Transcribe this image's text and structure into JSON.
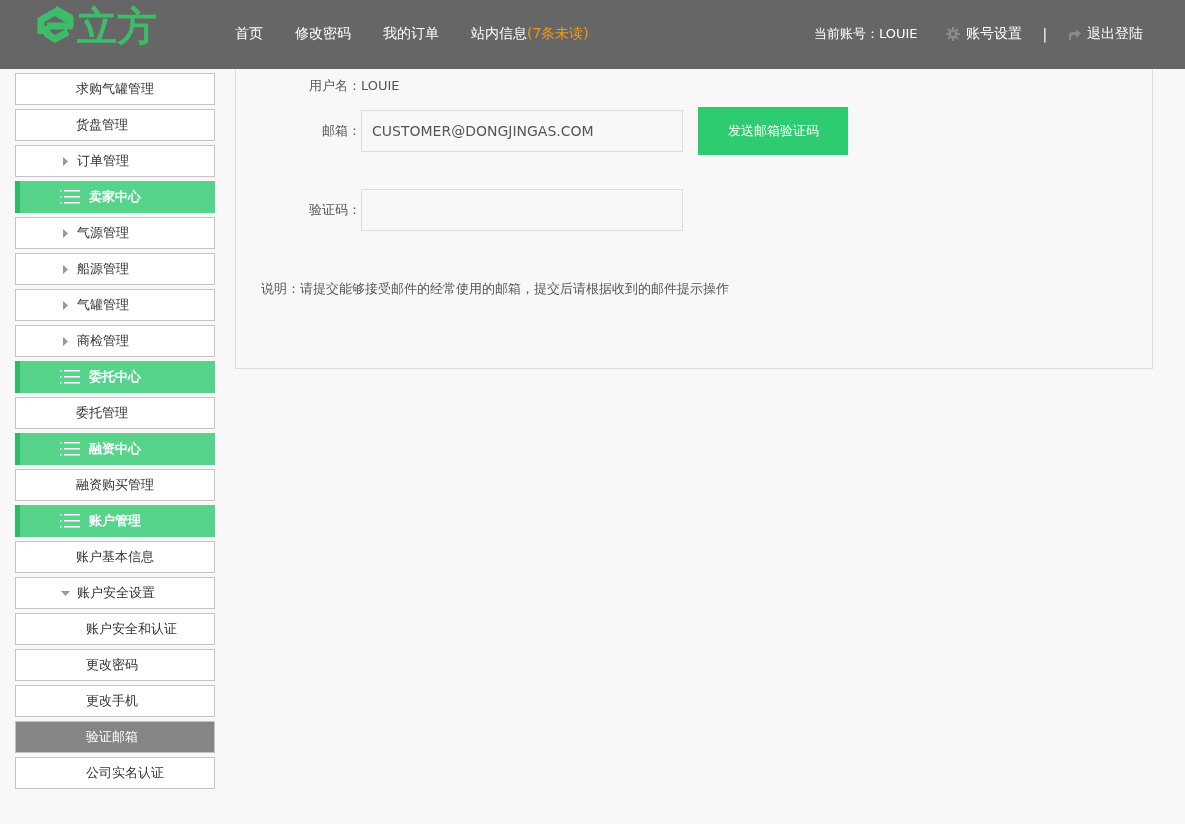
{
  "header": {
    "logo_text": "立方",
    "nav": [
      {
        "label": "首页"
      },
      {
        "label": "修改密码"
      },
      {
        "label": "我的订单"
      },
      {
        "label": "站内信息",
        "badge": "(7条未读)"
      }
    ],
    "account": "当前账号：LOUIE",
    "settings": "账号设置",
    "separator": "|",
    "logout": "退出登陆"
  },
  "sidebar": {
    "items": [
      {
        "kind": "item",
        "label": "求购气罐管理",
        "selected": false
      },
      {
        "kind": "item",
        "label": "货盘管理",
        "selected": false
      },
      {
        "kind": "group",
        "label": "订单管理",
        "expanded": false,
        "selected": false
      },
      {
        "kind": "header",
        "label": "卖家中心"
      },
      {
        "kind": "group",
        "label": "气源管理",
        "expanded": false,
        "selected": false
      },
      {
        "kind": "group",
        "label": "船源管理",
        "expanded": false,
        "selected": false
      },
      {
        "kind": "group",
        "label": "气罐管理",
        "expanded": false,
        "selected": false
      },
      {
        "kind": "group",
        "label": "商检管理",
        "expanded": false,
        "selected": false
      },
      {
        "kind": "header",
        "label": "委托中心"
      },
      {
        "kind": "item",
        "label": "委托管理",
        "selected": false
      },
      {
        "kind": "header",
        "label": "融资中心"
      },
      {
        "kind": "item",
        "label": "融资购买管理",
        "selected": false
      },
      {
        "kind": "header",
        "label": "账户管理"
      },
      {
        "kind": "item",
        "label": "账户基本信息",
        "selected": false
      },
      {
        "kind": "group",
        "label": "账户安全设置",
        "expanded": true,
        "selected": false,
        "children": [
          {
            "label": "账户安全和认证",
            "selected": false
          },
          {
            "label": "更改密码",
            "selected": false
          },
          {
            "label": "更改手机",
            "selected": false
          },
          {
            "label": "验证邮箱",
            "selected": true
          },
          {
            "label": "公司实名认证",
            "selected": false
          }
        ]
      }
    ]
  },
  "form": {
    "username": "用户名：LOUIE",
    "email": {
      "label": "邮箱：",
      "value": "CUSTOMER@DONGJINGAS.COM"
    },
    "send_button": "发送邮箱验证码",
    "code": {
      "label": "验证码："
    },
    "note": "说明：请提交能够接受邮件的经常使用的邮箱，提交后请根据收到的邮件提示操作"
  }
}
